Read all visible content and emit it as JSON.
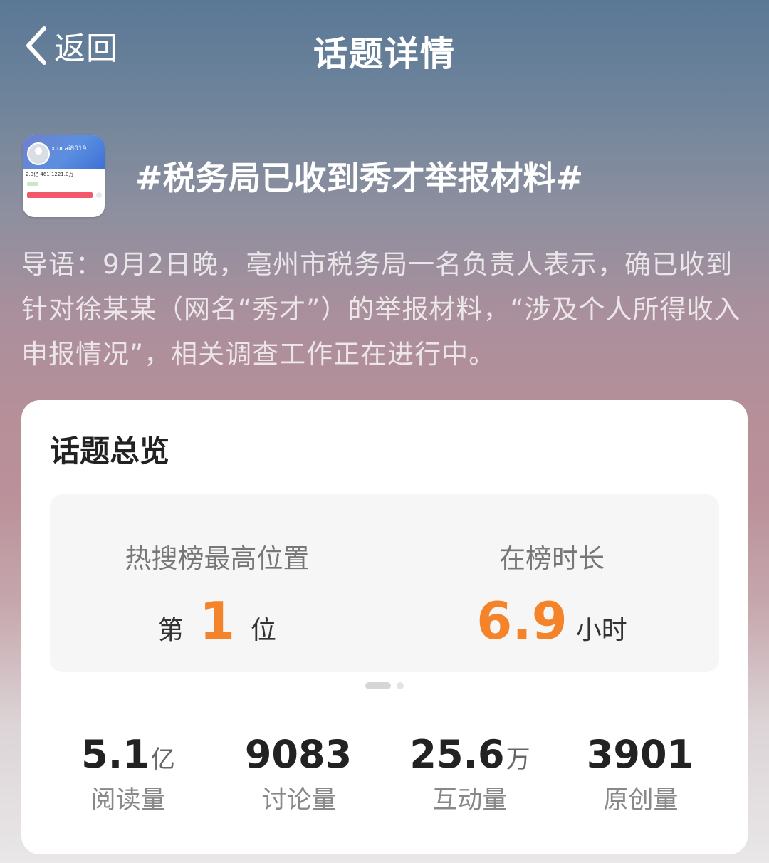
{
  "nav": {
    "back_label": "返回",
    "title": "话题详情"
  },
  "topic": {
    "thumbnail": {
      "username": "xiucai8019",
      "stats": "2.0亿  461  1221.0万"
    },
    "title": "#税务局已收到秀才举报材料#",
    "intro": "导语：9月2日晚，亳州市税务局一名负责人表示，确已收到针对徐某某（网名“秀才”）的举报材料，“涉及个人所得收入申报情况”，相关调查工作正在进行中。"
  },
  "overview": {
    "title": "话题总览",
    "rank": {
      "label": "热搜榜最高位置",
      "prefix": "第",
      "value": "1",
      "suffix": "位"
    },
    "duration": {
      "label": "在榜时长",
      "value": "6.9",
      "unit": "小时"
    },
    "pager": {
      "pages": 2,
      "current": 1
    },
    "stats": [
      {
        "value": "5.1",
        "unit": "亿",
        "label": "阅读量"
      },
      {
        "value": "9083",
        "unit": "",
        "label": "讨论量"
      },
      {
        "value": "25.6",
        "unit": "万",
        "label": "互动量"
      },
      {
        "value": "3901",
        "unit": "",
        "label": "原创量"
      }
    ]
  },
  "colors": {
    "accent": "#f5832a",
    "card_bg": "#ffffff",
    "panel_bg": "#f6f6f6"
  }
}
